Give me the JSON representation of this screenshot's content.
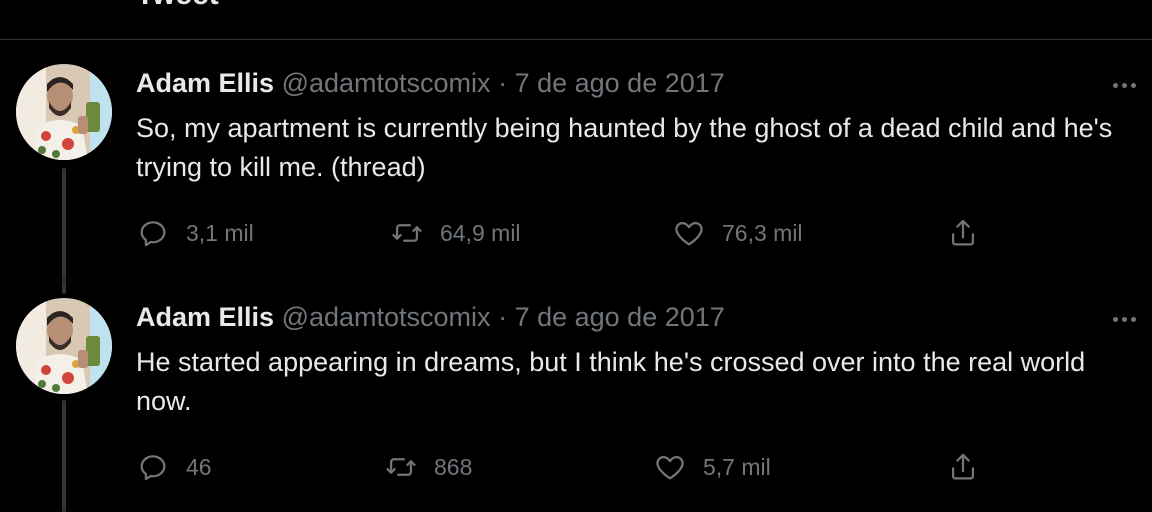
{
  "header": {
    "title": "Tweet"
  },
  "tweets": [
    {
      "author_name": "Adam Ellis",
      "handle": "@adamtotscomix",
      "separator": "·",
      "date": "7 de ago de 2017",
      "text": "So, my apartment is currently being haunted by the ghost of a dead child and he's trying to kill me. (thread)",
      "replies": "3,1 mil",
      "retweets": "64,9 mil",
      "likes": "76,3 mil"
    },
    {
      "author_name": "Adam Ellis",
      "handle": "@adamtotscomix",
      "separator": "·",
      "date": "7 de ago de 2017",
      "text": "He started appearing in dreams, but I think he's crossed over into the real world now.",
      "replies": "46",
      "retweets": "868",
      "likes": "5,7 mil"
    }
  ],
  "icons": {
    "reply": "reply-icon",
    "retweet": "retweet-icon",
    "like": "heart-icon",
    "share": "share-icon",
    "more": "more-options-icon"
  },
  "colors": {
    "background": "#000000",
    "text_primary": "#e7e9ea",
    "text_secondary": "#71767b",
    "divider": "#2f3336",
    "thread_line": "#333639"
  }
}
